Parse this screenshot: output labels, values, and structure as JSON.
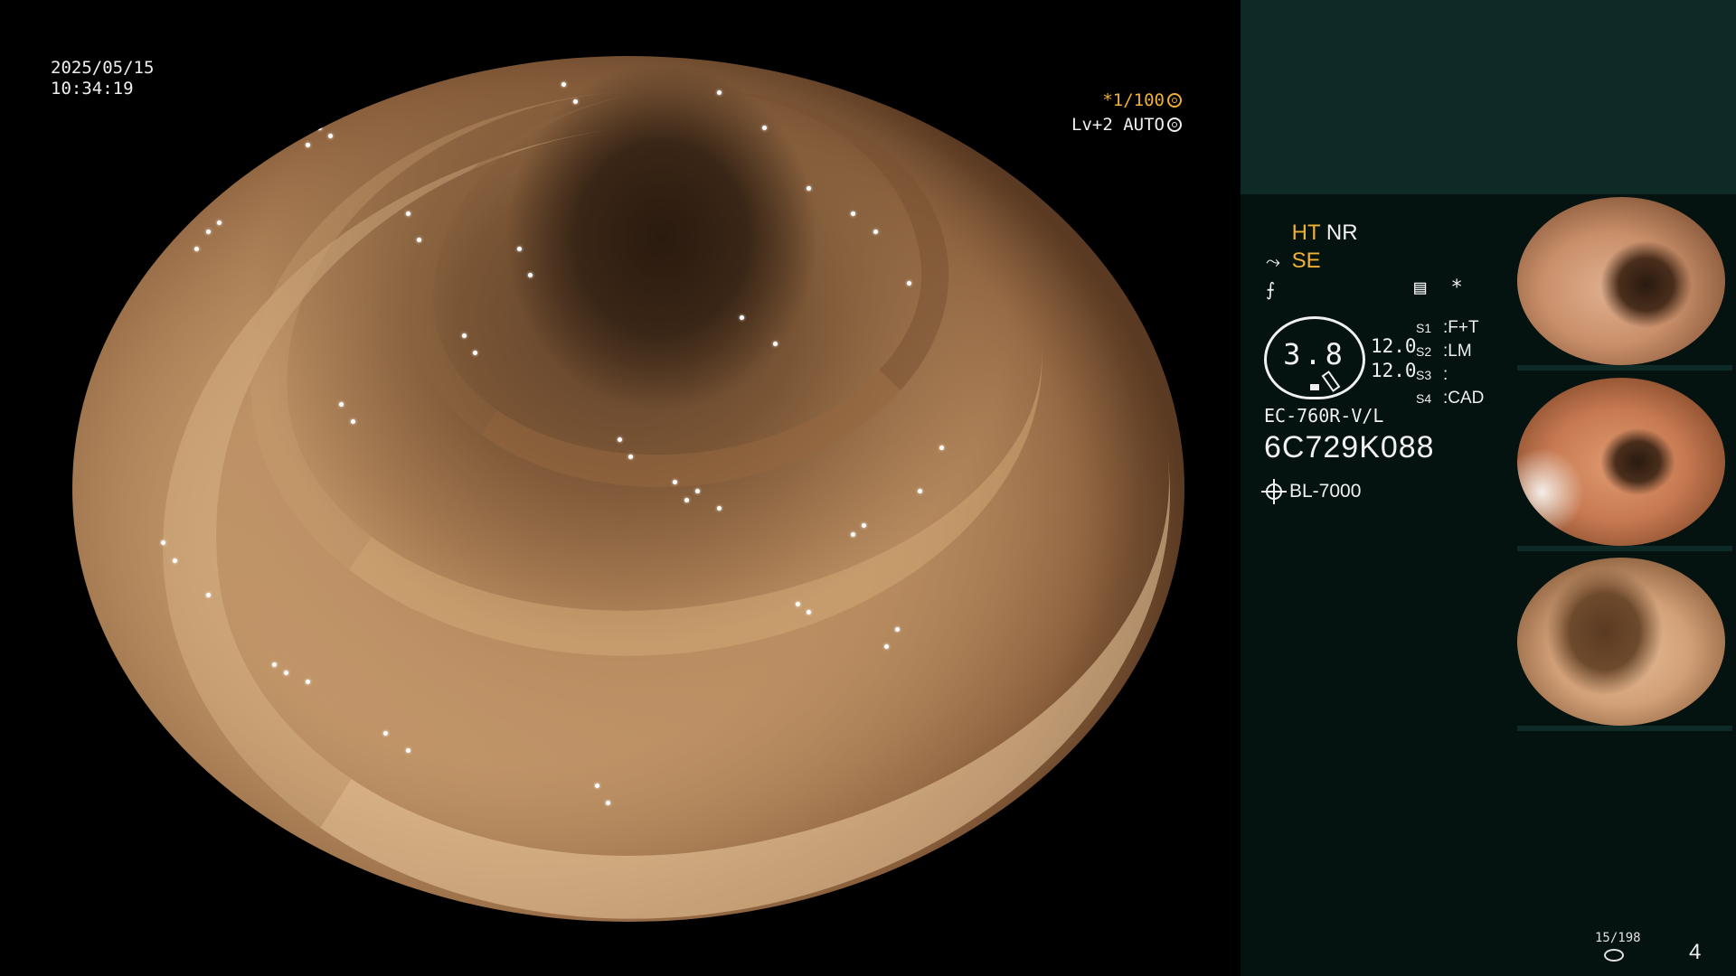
{
  "overlay": {
    "date": "2025/05/15",
    "time": "10:34:19",
    "shutter": "*1/100",
    "iris": "Lv+2 AUTO"
  },
  "panel": {
    "modes": {
      "ht": "HT",
      "nr": "NR",
      "se": "SE"
    },
    "freeze_icon": "image-freeze-icon",
    "asterisk": "*",
    "gauge_value": "3.8",
    "gauge_readings": [
      "12.0",
      "12.0"
    ],
    "scope_settings": [
      {
        "key": "S1",
        "value": "F+T"
      },
      {
        "key": "S2",
        "value": "LM"
      },
      {
        "key": "S3",
        "value": ""
      },
      {
        "key": "S4",
        "value": "CAD"
      }
    ],
    "scope_model": "EC-760R-V/L",
    "scope_serial": "6C729K088",
    "light_source": "BL-7000",
    "counter": "15/198",
    "page_number": "4"
  },
  "colors": {
    "panel_bg": "#041210",
    "panel_top": "#0d2a27",
    "accent_yellow": "#f0b030",
    "text": "#f0f0f0"
  }
}
